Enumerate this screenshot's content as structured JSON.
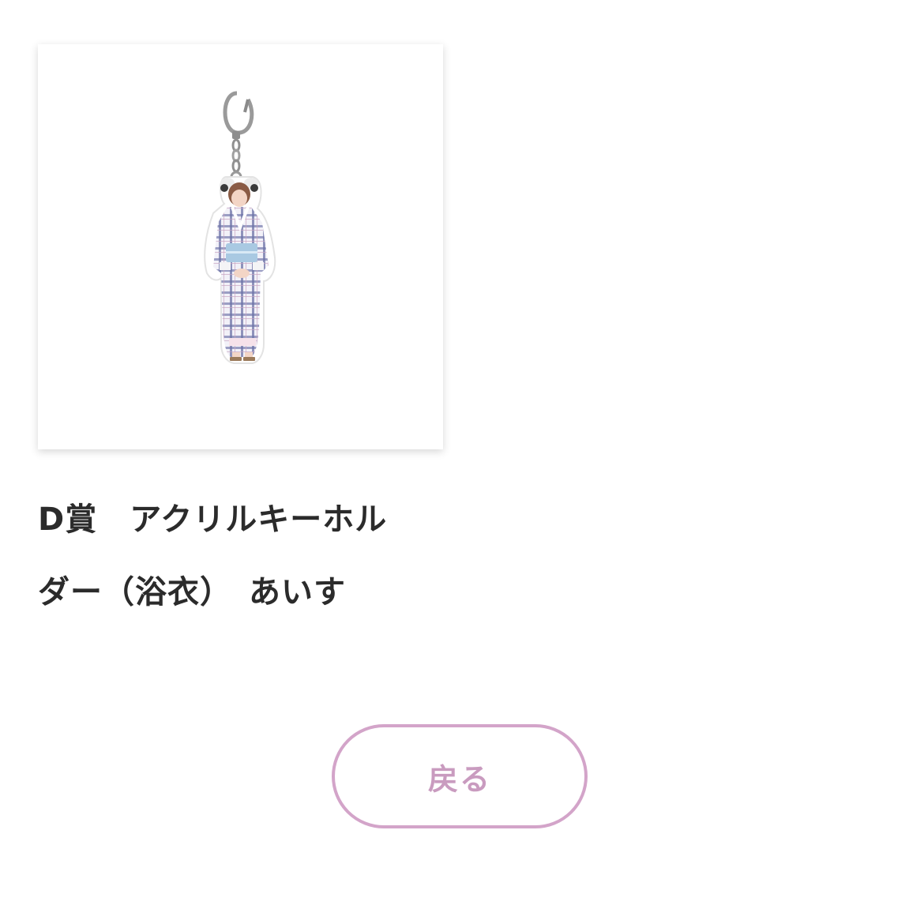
{
  "product": {
    "title_line1": "D賞　アクリルキーホル",
    "title_line2": "ダー（浴衣）　あいす",
    "image_icon": "acrylic-keychain-photo"
  },
  "actions": {
    "back_label": "戻る"
  },
  "colors": {
    "accent": "#d3a4c9",
    "accent_text": "#c99bbf",
    "title_text": "#2b2b2b",
    "background": "#ffffff"
  }
}
